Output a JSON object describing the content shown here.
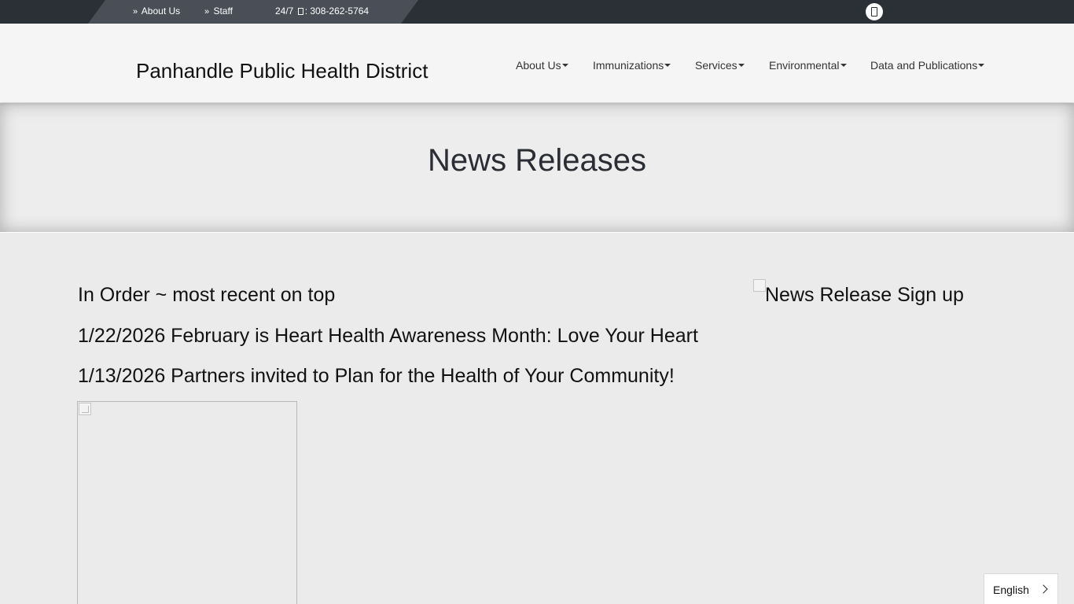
{
  "topbar": {
    "about_label": "About Us",
    "staff_label": "Staff",
    "phone_prefix": "24/7",
    "phone_number": ": 308-262-5764"
  },
  "header": {
    "site_title": "Panhandle Public Health District",
    "nav": [
      {
        "label": "About Us"
      },
      {
        "label": "Immunizations"
      },
      {
        "label": "Services"
      },
      {
        "label": "Environmental"
      },
      {
        "label": "Data and Publications"
      }
    ]
  },
  "banner": {
    "title": "News Releases"
  },
  "main": {
    "order_note": "In Order ~ most recent on top",
    "releases": [
      {
        "text": "1/22/2026 February is Heart Health Awareness Month: Love Your Heart"
      },
      {
        "text": "1/13/2026 Partners invited to Plan for the Health of Your Community!"
      }
    ],
    "signup_alt": "News Release Sign up"
  },
  "language": {
    "selected": "English"
  },
  "colors": {
    "topbar_bg": "#2b2f36",
    "topbar_strip": "#4a4e56",
    "header_bg": "#f5f5f5",
    "page_bg": "#ebebeb"
  }
}
